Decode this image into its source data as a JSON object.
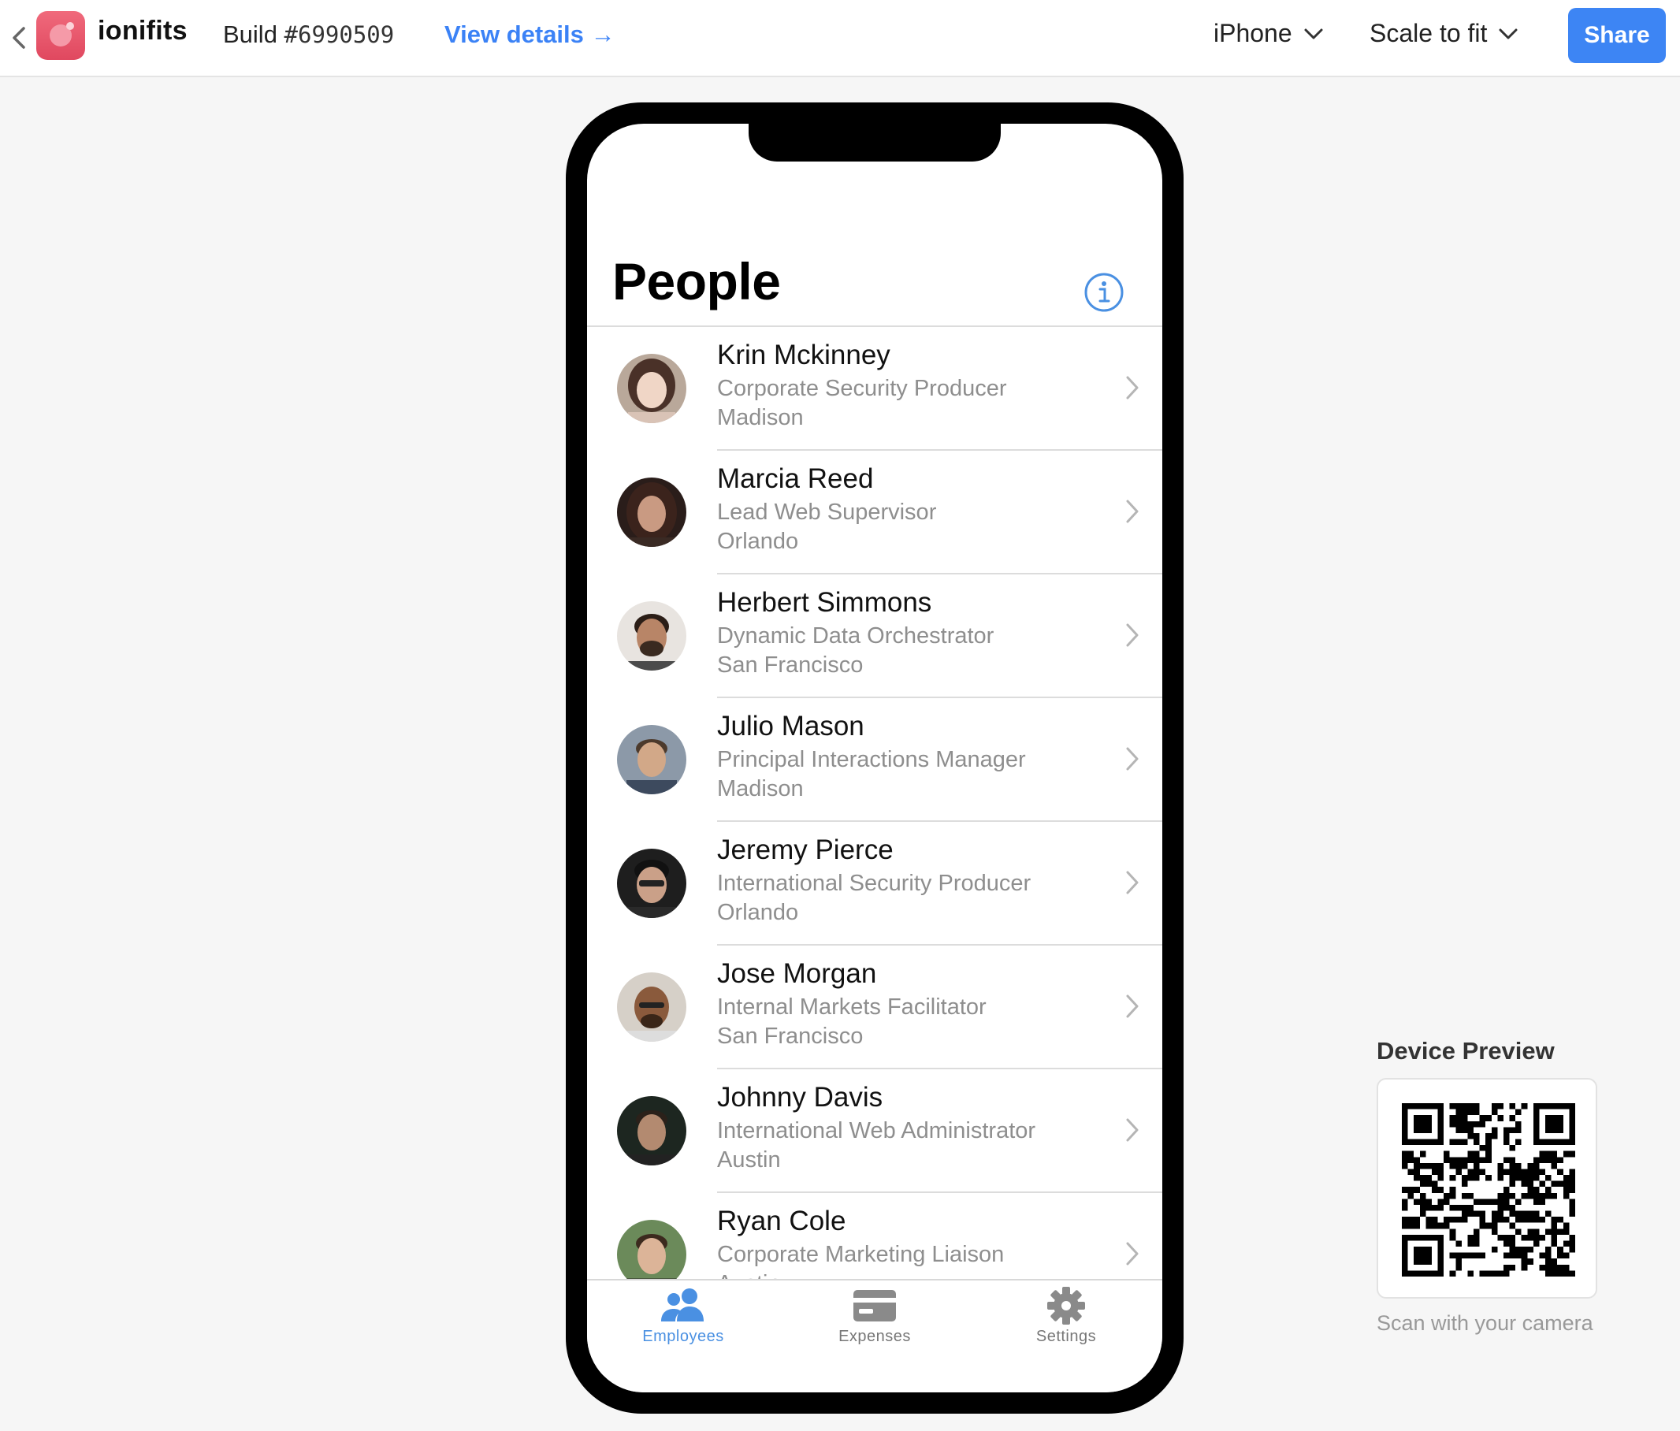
{
  "header": {
    "app_name": "ionifits",
    "build_prefix": "Build ",
    "build_number": "#6990509",
    "view_details": "View details →",
    "device_select": "iPhone",
    "scale_select": "Scale to fit",
    "share": "Share"
  },
  "screen": {
    "title": "People",
    "employees": [
      {
        "name": "Krin Mckinney",
        "role": "Corporate Security Producer",
        "city": "Madison"
      },
      {
        "name": "Marcia Reed",
        "role": "Lead Web Supervisor",
        "city": "Orlando"
      },
      {
        "name": "Herbert Simmons",
        "role": "Dynamic Data Orchestrator",
        "city": "San Francisco"
      },
      {
        "name": "Julio Mason",
        "role": "Principal Interactions Manager",
        "city": "Madison"
      },
      {
        "name": "Jeremy Pierce",
        "role": "International Security Producer",
        "city": "Orlando"
      },
      {
        "name": "Jose Morgan",
        "role": "Internal Markets Facilitator",
        "city": "San Francisco"
      },
      {
        "name": "Johnny Davis",
        "role": "International Web Administrator",
        "city": "Austin"
      },
      {
        "name": "Ryan Cole",
        "role": "Corporate Marketing Liaison",
        "city": "Austin"
      }
    ],
    "tabs": [
      {
        "label": "Employees",
        "icon": "people-icon",
        "active": true
      },
      {
        "label": "Expenses",
        "icon": "card-icon",
        "active": false
      },
      {
        "label": "Settings",
        "icon": "gear-icon",
        "active": false
      }
    ]
  },
  "device_preview": {
    "title": "Device Preview",
    "caption": "Scan with your camera"
  },
  "colors": {
    "accent": "#3d85f4",
    "tab_active": "#4a90e2",
    "app_icon": "#e9566b"
  }
}
